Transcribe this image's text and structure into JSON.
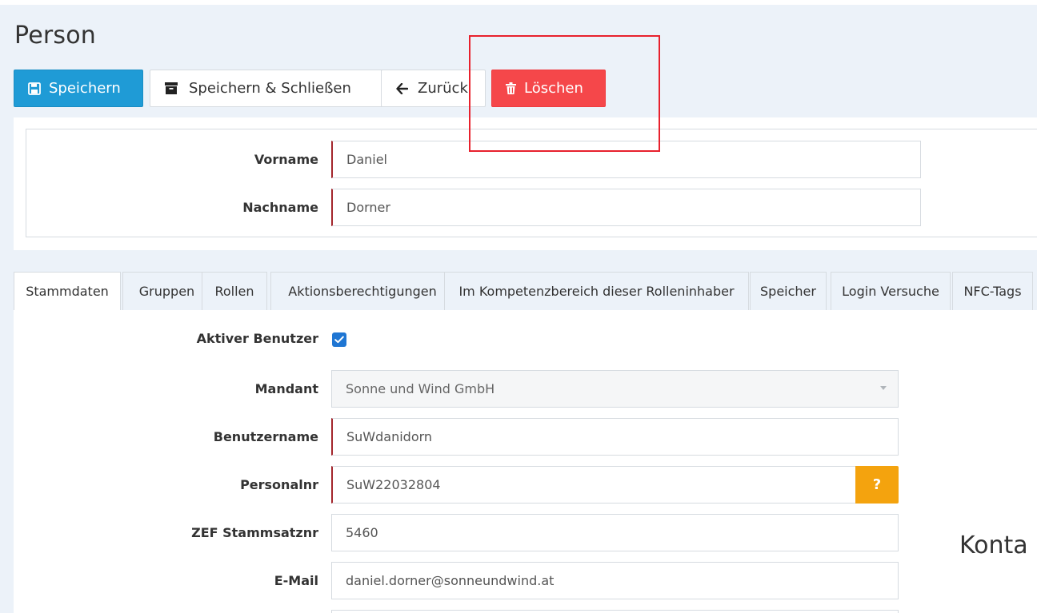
{
  "page": {
    "title": "Person"
  },
  "toolbar": {
    "save_label": "Speichern",
    "save_close_label": "Speichern & Schließen",
    "back_label": "Zurück",
    "delete_label": "Löschen"
  },
  "name_panel": {
    "first_name": {
      "label": "Vorname",
      "value": "Daniel"
    },
    "last_name": {
      "label": "Nachname",
      "value": "Dorner"
    }
  },
  "tabs": [
    {
      "label": "Stammdaten",
      "active": true
    },
    {
      "label": "Gruppen"
    },
    {
      "label": "Rollen"
    },
    {
      "label": "Aktionsberechtigungen"
    },
    {
      "label": "Im Kompetenzbereich dieser Rolleninhaber"
    },
    {
      "label": "Speicher"
    },
    {
      "label": "Login Versuche"
    },
    {
      "label": "NFC-Tags"
    }
  ],
  "stammdaten": {
    "active_user": {
      "label": "Aktiver Benutzer",
      "checked": true
    },
    "tenant": {
      "label": "Mandant",
      "value": "Sonne und Wind GmbH"
    },
    "username": {
      "label": "Benutzername",
      "value": "SuWdanidorn"
    },
    "personnel_no": {
      "label": "Personalnr",
      "value": "SuW22032804",
      "help": "?"
    },
    "zef_no": {
      "label": "ZEF Stammsatznr",
      "value": "5460"
    },
    "email": {
      "label": "E-Mail",
      "value": "daniel.dorner@sonneundwind.at"
    }
  },
  "contact_section": {
    "heading": "Konta"
  },
  "colors": {
    "primary": "#1f9bd6",
    "danger": "#f5474a",
    "warning": "#f4a30e",
    "required_marker": "#a3252c",
    "highlight": "#e8212d",
    "page_background": "#ecf2f9"
  },
  "icons": {
    "save": "floppy-disk-icon",
    "save_close": "archive-box-icon",
    "back": "arrow-left-icon",
    "delete": "trash-icon",
    "checkbox": "checkmark-icon",
    "select": "caret-down-icon"
  }
}
